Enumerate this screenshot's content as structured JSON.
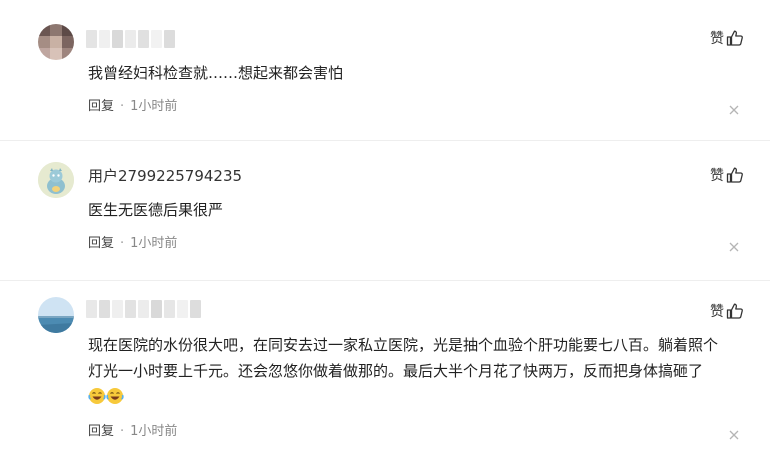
{
  "comments": [
    {
      "username": "",
      "text": "我曾经妇科检查就……想起来都会害怕",
      "like_label": "赞",
      "reply_label": "回复",
      "separator": "·",
      "time": "1小时前"
    },
    {
      "username": "用户2799225794235",
      "text": "医生无医德后果很严",
      "like_label": "赞",
      "reply_label": "回复",
      "separator": "·",
      "time": "1小时前"
    },
    {
      "username": "",
      "text": "现在医院的水份很大吧，在同安去过一家私立医院，光是抽个血验个肝功能要七八百。躺着照个灯光一小时要上千元。还会忽悠你做着做那的。最后大半个月花了快两万，反而把身体搞砸了",
      "emojis": [
        "laughing-crying-emoji",
        "laughing-crying-emoji"
      ],
      "like_label": "赞",
      "reply_label": "回复",
      "separator": "·",
      "time": "1小时前"
    }
  ],
  "colors": {
    "text": "#222222",
    "meta": "#888888",
    "divider": "#eeeeee"
  }
}
